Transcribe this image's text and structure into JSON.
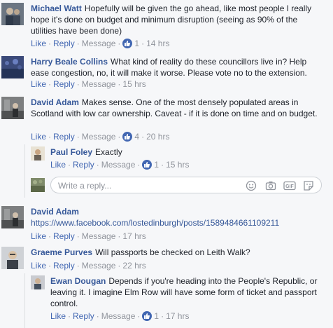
{
  "labels": {
    "like": "Like",
    "reply": "Reply",
    "message": "Message",
    "dot": "·"
  },
  "comments": [
    {
      "author": "Michael Watt",
      "text": "Hopefully will be given the go ahead, like most people I really hope it's done on budget and minimum disruption (seeing as 90% of the utilities have been done)",
      "likes": "1",
      "time": "14 hrs"
    },
    {
      "author": "Harry Beale Collins",
      "text": "What kind of reality do these councillors live in? Help ease congestion, no, it will make it worse. Please vote no to the extension.",
      "time": "15 hrs"
    },
    {
      "author": "David Adam",
      "text": "Makes sense. One of the most densely populated areas in Scotland with low car ownership. Caveat - if it is done on time and on budget.",
      "likes": "4",
      "time": "20 hrs",
      "replies": [
        {
          "author": "Paul Foley",
          "text": "Exactly",
          "likes": "1",
          "time": "15 hrs"
        }
      ]
    },
    {
      "author": "David Adam",
      "link": "https://www.facebook.com/lostedinburgh/posts/1589484661109211",
      "time": "17 hrs"
    },
    {
      "author": "Graeme Purves",
      "text": "Will passports be checked on Leith Walk?",
      "time": "22 hrs",
      "replies": [
        {
          "author": "Ewan Dougan",
          "text": "Depends if you're heading into the People's Republic, or leaving it. I imagine Elm Row will have some form of ticket and passport control.",
          "likes": "1",
          "time": "17 hrs"
        }
      ]
    }
  ],
  "reply_box": {
    "placeholder": "Write a reply..."
  },
  "colors": {
    "link": "#365899",
    "action": "#4267b2",
    "muted": "#90949c",
    "background": "#f6f7f9"
  }
}
